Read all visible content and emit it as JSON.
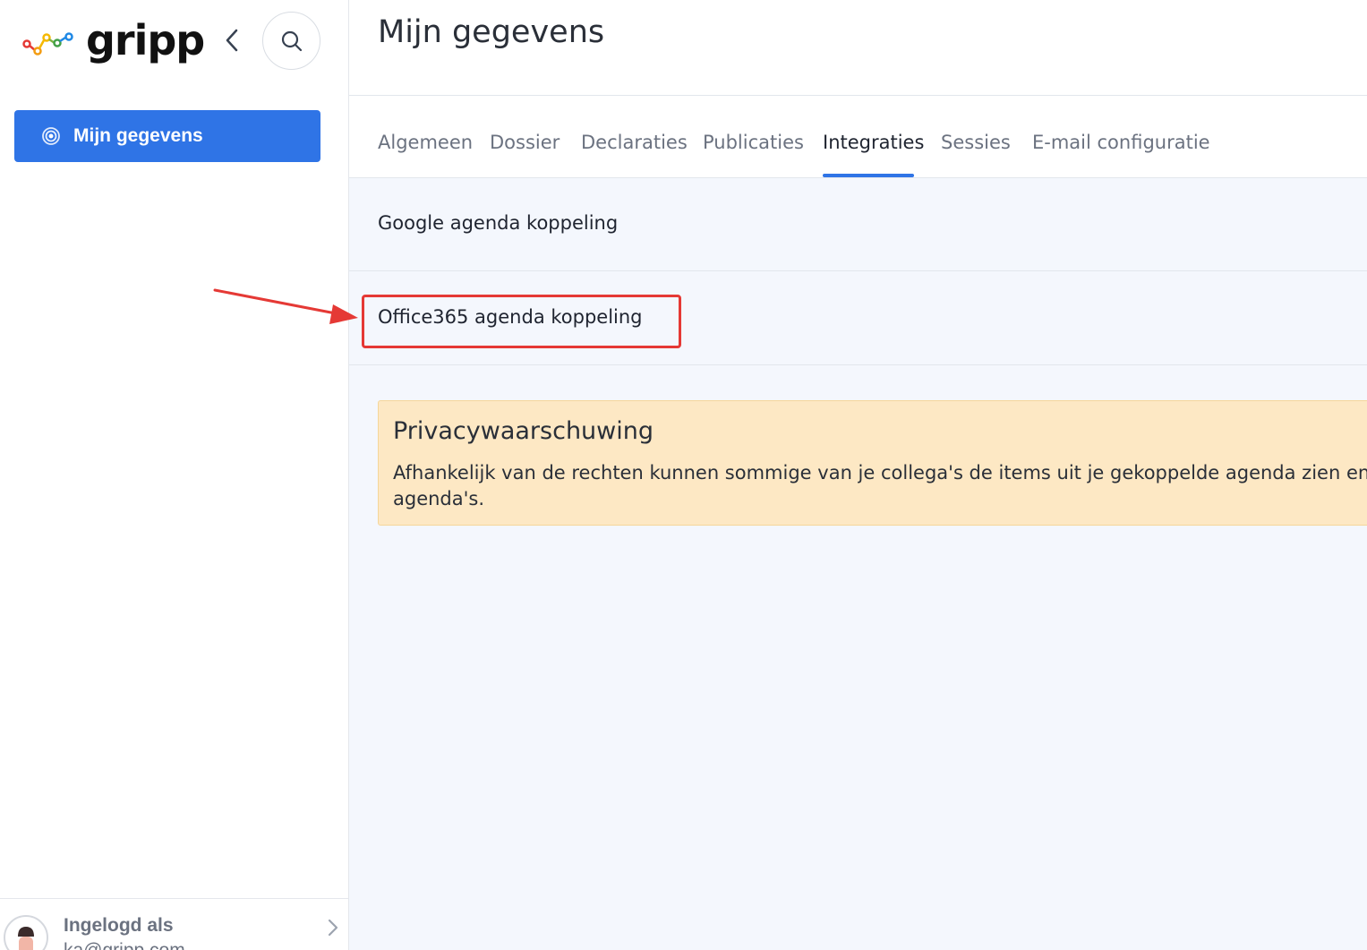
{
  "brand": {
    "name": "gripp",
    "accent": "#2f74e6"
  },
  "sidebar": {
    "collapse_icon": "chevron-left-icon",
    "search_icon": "search-icon",
    "nav_item": {
      "label": "Mijn gegevens",
      "icon": "target-icon"
    },
    "footer": {
      "label": "Ingelogd als",
      "email": "ka@gripp.com"
    }
  },
  "header": {
    "title": "Mijn gegevens"
  },
  "tabs": [
    {
      "label": "Algemeen",
      "active": false
    },
    {
      "label": "Dossier",
      "active": false
    },
    {
      "label": "Declaraties",
      "active": false
    },
    {
      "label": "Publicaties",
      "active": false
    },
    {
      "label": "Integraties",
      "active": true
    },
    {
      "label": "Sessies",
      "active": false
    },
    {
      "label": "E-mail configuratie",
      "active": false
    }
  ],
  "integrations": [
    {
      "label": "Google agenda koppeling"
    },
    {
      "label": "Office365 agenda koppeling",
      "highlighted": true
    }
  ],
  "warning": {
    "title": "Privacywaarschuwing",
    "text": "Afhankelijk van de rechten kunnen sommige van je collega's de items uit je gekoppelde agenda zien en aa agenda's."
  },
  "annotation_color": "#e53935"
}
